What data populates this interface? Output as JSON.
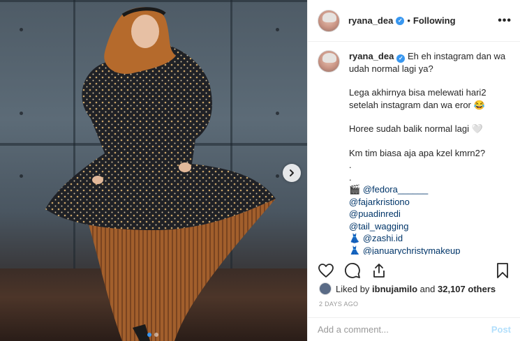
{
  "post": {
    "username": "ryana_dea",
    "verified_mark": "✓",
    "separator": "•",
    "follow_status": "Following",
    "more_label": "•••"
  },
  "caption": {
    "username": "ryana_dea",
    "line1": "Eh eh instagram dan wa udah normal lagi ya?",
    "line2": "Lega akhirnya bisa melewati hari2 setelah instagram dan wa eror 😂",
    "line3": "Horee sudah balik normal lagi 🤍",
    "line4": "Km tim biasa aja apa kzel kmrn2?",
    "dot1": ".",
    "dot2": ".",
    "credit1_emoji": "🎬",
    "credit1": "@fedora______",
    "credit2": "@fajarkristiono",
    "credit3": "@puadinredi",
    "credit4": "@tail_wagging",
    "credit5_emoji": "👗",
    "credit5": "@zashi.id",
    "credit6_emoji": "👗",
    "credit6": "@januarychristymakeup",
    "age": "2d"
  },
  "actions": {
    "like_icon": "heart-icon",
    "comment_icon": "comment-icon",
    "share_icon": "share-icon",
    "save_icon": "bookmark-icon"
  },
  "likes": {
    "prefix": "Liked by",
    "user": "ibnujamilo",
    "middle": "and",
    "count": "32,107 others"
  },
  "timestamp": "2 DAYS AGO",
  "comment_box": {
    "placeholder": "Add a comment...",
    "post_label": "Post"
  },
  "carousel": {
    "slide_count": 2,
    "active_index": 0
  },
  "colors": {
    "accent": "#3897f0",
    "mention": "#003569",
    "muted": "#999999",
    "post_disabled": "#b2dffc"
  }
}
